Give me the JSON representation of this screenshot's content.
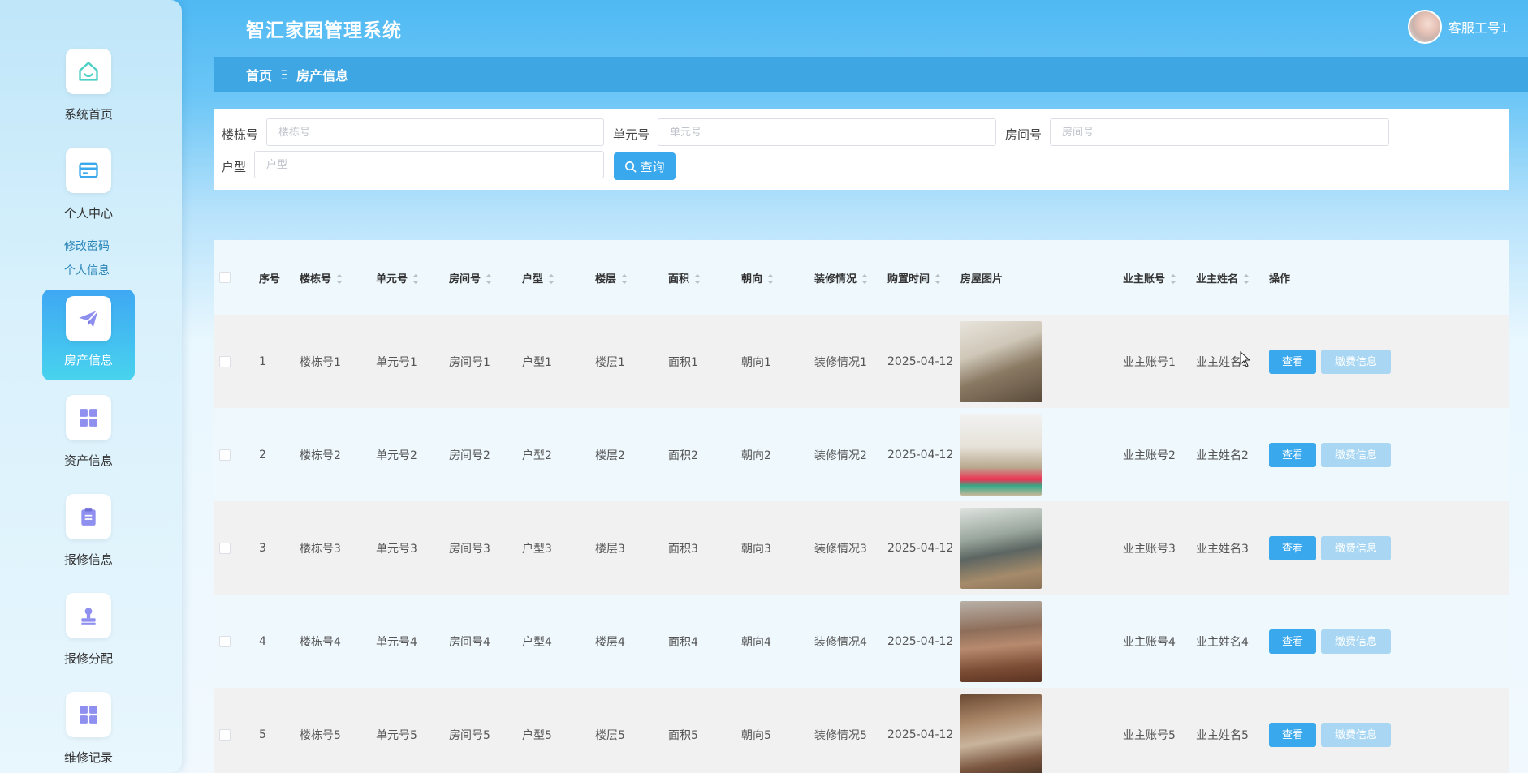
{
  "app": {
    "title": "智汇家园管理系统"
  },
  "user": {
    "name": "客服工号1"
  },
  "breadcrumb": {
    "home": "首页",
    "separator": "Ξ",
    "current": "房产信息"
  },
  "sidebar": {
    "items": [
      {
        "label": "系统首页",
        "icon": "home-icon"
      },
      {
        "label": "个人中心",
        "icon": "card-icon"
      },
      {
        "label": "房产信息",
        "icon": "paper-plane-icon",
        "active": true
      },
      {
        "label": "资产信息",
        "icon": "grid-icon"
      },
      {
        "label": "报修信息",
        "icon": "clipboard-icon"
      },
      {
        "label": "报修分配",
        "icon": "stamp-icon"
      },
      {
        "label": "维修记录",
        "icon": "grid-icon"
      }
    ],
    "submenu": [
      "修改密码",
      "个人信息"
    ]
  },
  "search": {
    "fields": [
      {
        "label": "楼栋号",
        "placeholder": "楼栋号"
      },
      {
        "label": "单元号",
        "placeholder": "单元号"
      },
      {
        "label": "房间号",
        "placeholder": "房间号"
      },
      {
        "label": "户型",
        "placeholder": "户型"
      }
    ],
    "button": "查询"
  },
  "table": {
    "columns": [
      "序号",
      "楼栋号",
      "单元号",
      "房间号",
      "户型",
      "楼层",
      "面积",
      "朝向",
      "装修情况",
      "购置时间",
      "房屋图片",
      "业主账号",
      "业主姓名",
      "操作"
    ],
    "rows": [
      {
        "no": "1",
        "building": "楼栋号1",
        "unit": "单元号1",
        "room": "房间号1",
        "type": "户型1",
        "floor": "楼层1",
        "area": "面积1",
        "orientation": "朝向1",
        "decoration": "装修情况1",
        "date": "2025-04-12",
        "account": "业主账号1",
        "owner": "业主姓名1"
      },
      {
        "no": "2",
        "building": "楼栋号2",
        "unit": "单元号2",
        "room": "房间号2",
        "type": "户型2",
        "floor": "楼层2",
        "area": "面积2",
        "orientation": "朝向2",
        "decoration": "装修情况2",
        "date": "2025-04-12",
        "account": "业主账号2",
        "owner": "业主姓名2"
      },
      {
        "no": "3",
        "building": "楼栋号3",
        "unit": "单元号3",
        "room": "房间号3",
        "type": "户型3",
        "floor": "楼层3",
        "area": "面积3",
        "orientation": "朝向3",
        "decoration": "装修情况3",
        "date": "2025-04-12",
        "account": "业主账号3",
        "owner": "业主姓名3"
      },
      {
        "no": "4",
        "building": "楼栋号4",
        "unit": "单元号4",
        "room": "房间号4",
        "type": "户型4",
        "floor": "楼层4",
        "area": "面积4",
        "orientation": "朝向4",
        "decoration": "装修情况4",
        "date": "2025-04-12",
        "account": "业主账号4",
        "owner": "业主姓名4"
      },
      {
        "no": "5",
        "building": "楼栋号5",
        "unit": "单元号5",
        "room": "房间号5",
        "type": "户型5",
        "floor": "楼层5",
        "area": "面积5",
        "orientation": "朝向5",
        "decoration": "装修情况5",
        "date": "2025-04-12",
        "account": "业主账号5",
        "owner": "业主姓名5"
      }
    ],
    "actions": {
      "view": "查看",
      "pay": "缴费信息"
    }
  },
  "colors": {
    "primary": "#3aa8ed",
    "header": "#3ea6e2",
    "icon": "#8f8ff0",
    "home_icon": "#4ccfc5"
  }
}
